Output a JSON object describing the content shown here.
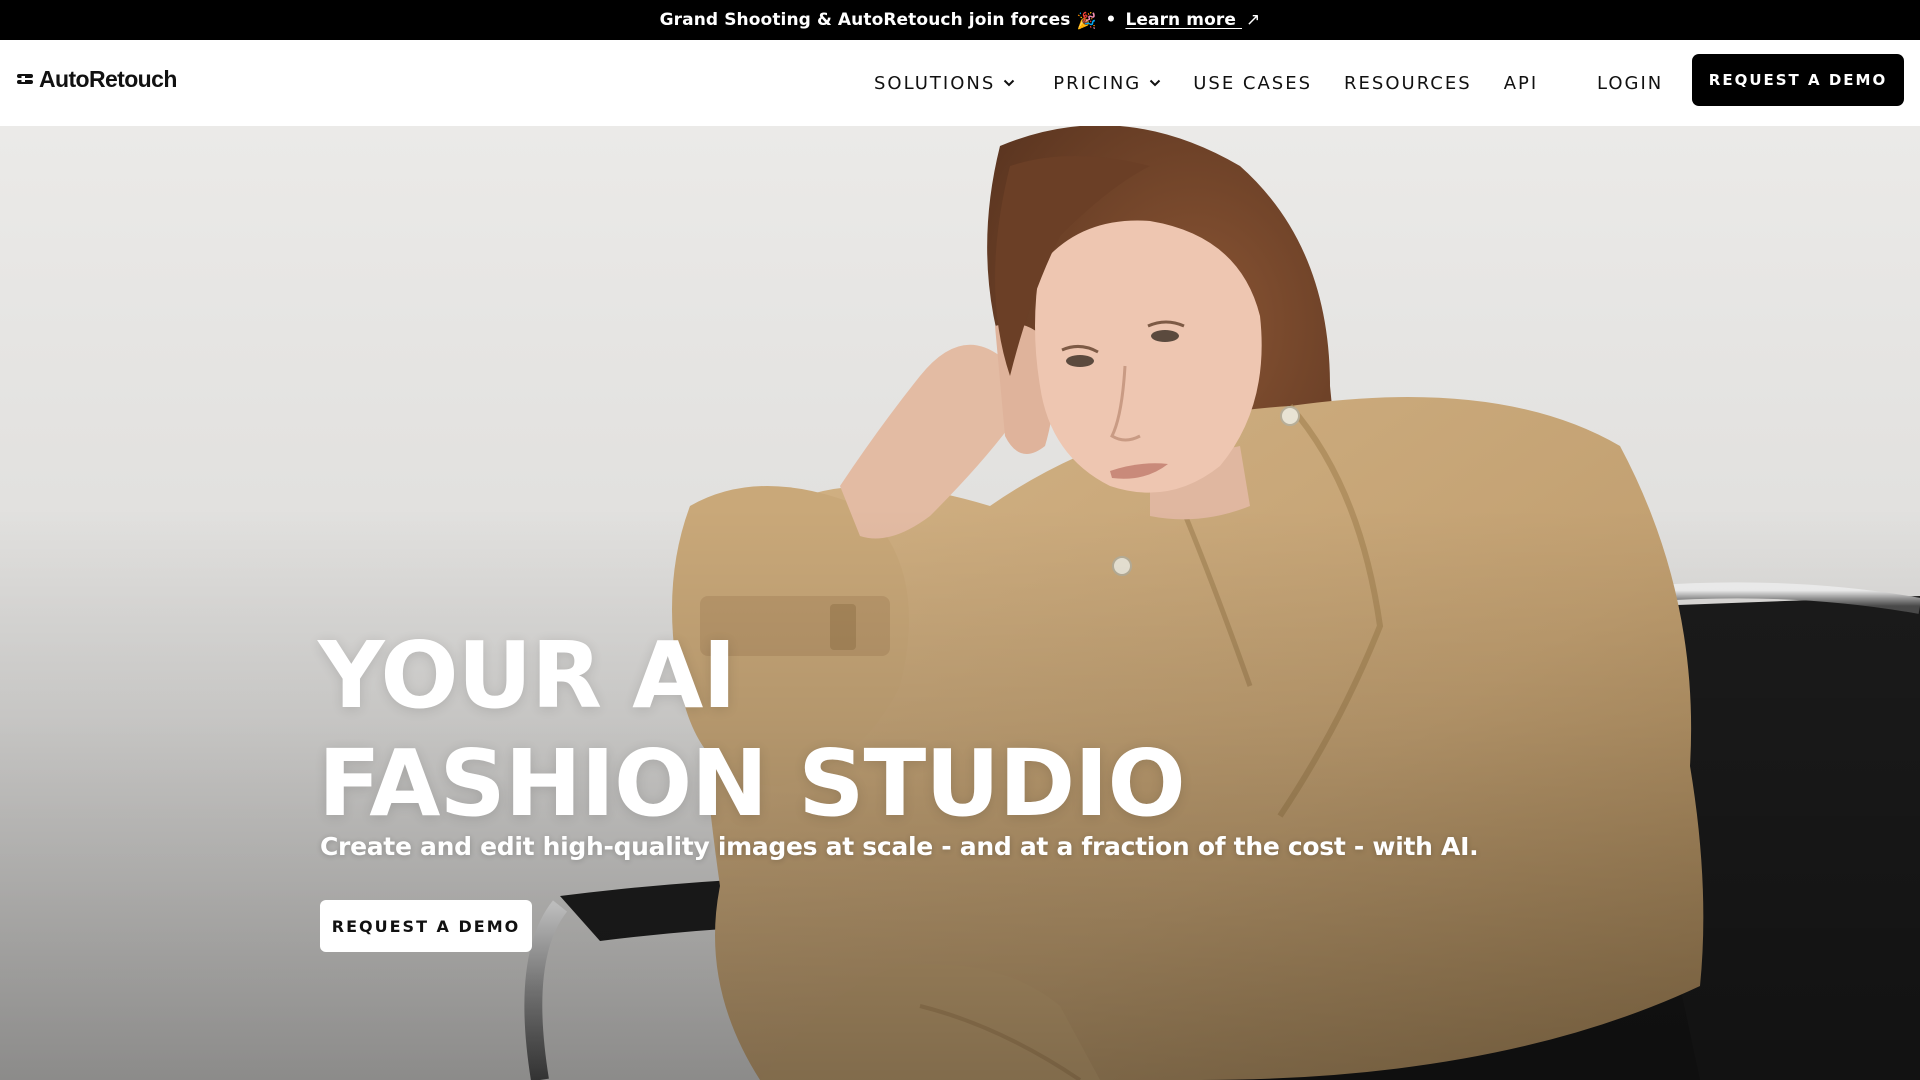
{
  "announcement": {
    "text": "Grand Shooting & AutoRetouch join forces",
    "emoji": "🎉",
    "separator": "•",
    "link_label": "Learn more",
    "link_arrow": "↗"
  },
  "header": {
    "logo_text": "AutoRetouch",
    "logo_icon": "autoretouch-logo-icon",
    "nav": {
      "solutions": "SOLUTIONS",
      "pricing": "PRICING",
      "use_cases": "USE CASES",
      "resources": "RESOURCES",
      "api": "API"
    },
    "login_label": "LOGIN",
    "demo_label": "REQUEST A DEMO"
  },
  "hero": {
    "title_line1": "YOUR AI",
    "title_line2": "FASHION STUDIO",
    "subtitle": "Create and edit high-quality images at scale - and at a fraction of the cost - with AI.",
    "cta_label": "REQUEST A DEMO",
    "image_description_icon": "fashion-model-photo"
  },
  "colors": {
    "announcement_bg": "#000000",
    "header_bg": "#ffffff",
    "primary_button_bg": "#000000",
    "hero_button_bg": "#ffffff",
    "coat": "#c9a879",
    "chair": "#1b1b1b",
    "hair": "#7a4a2c"
  }
}
